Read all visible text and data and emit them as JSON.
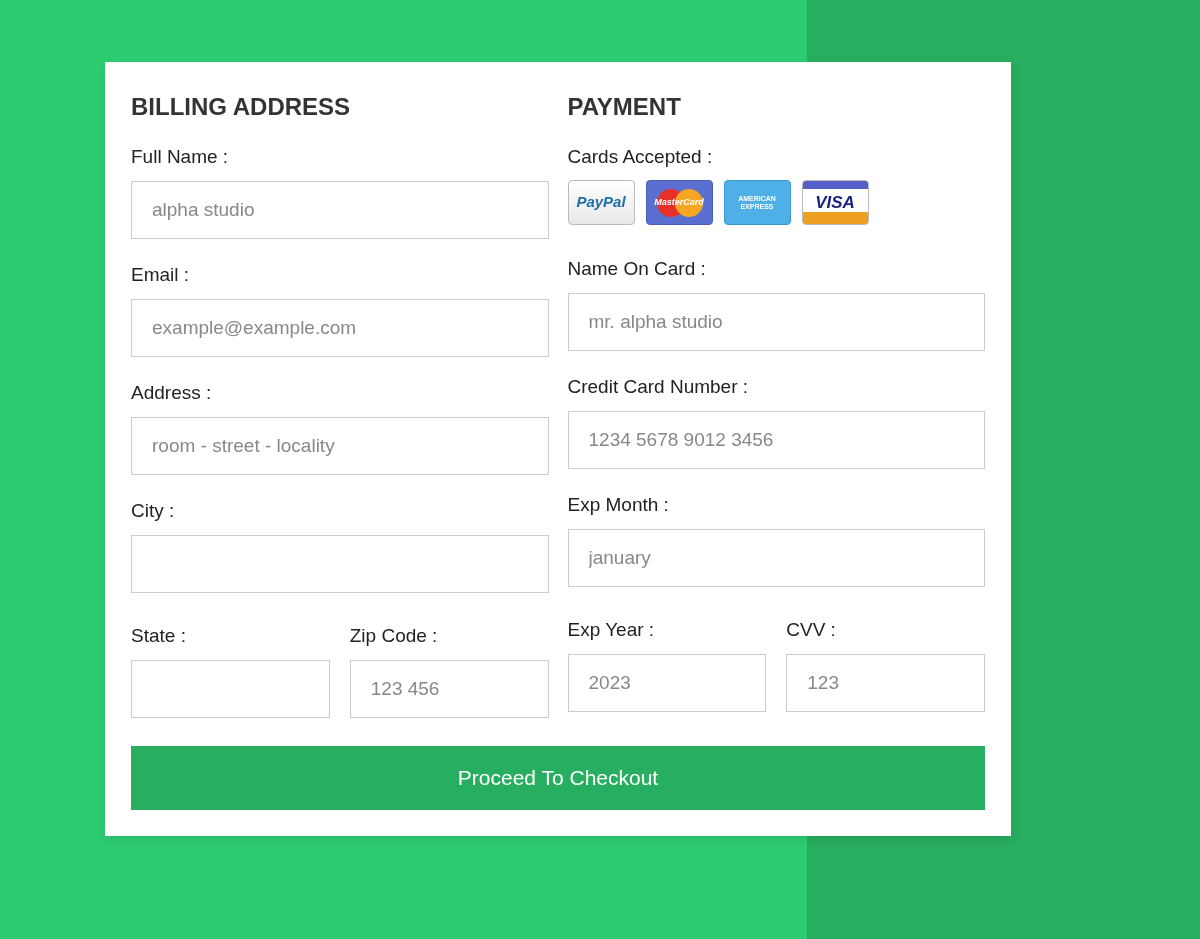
{
  "columns": [
    {
      "heading": "BILLING ADDRESS",
      "items": [
        {
          "kind": "field",
          "label": "Full Name :",
          "placeholder": "alpha studio"
        },
        {
          "kind": "field",
          "label": "Email :",
          "placeholder": "example@example.com"
        },
        {
          "kind": "field",
          "label": "Address :",
          "placeholder": "room - street - locality"
        },
        {
          "kind": "field",
          "label": "City :"
        },
        {
          "kind": "pair",
          "fields": [
            {
              "label": "State :"
            },
            {
              "label": "Zip Code :",
              "placeholder": "123 456"
            }
          ]
        }
      ]
    },
    {
      "heading": "PAYMENT",
      "items": [
        {
          "kind": "cards",
          "label": "Cards Accepted :",
          "cards": [
            {
              "kind": "paypal",
              "text": "PayPal"
            },
            {
              "kind": "mastercard",
              "text": "MasterCard"
            },
            {
              "kind": "amex",
              "text": "AMERICAN EXPRESS"
            },
            {
              "kind": "visa",
              "text": "VISA"
            }
          ]
        },
        {
          "kind": "field",
          "label": "Name On Card :",
          "placeholder": "mr. alpha studio"
        },
        {
          "kind": "field",
          "label": "Credit Card Number :",
          "placeholder": "1234 5678 9012 3456"
        },
        {
          "kind": "field",
          "label": "Exp Month :",
          "placeholder": "january"
        },
        {
          "kind": "pair",
          "fields": [
            {
              "label": "Exp Year :",
              "placeholder": "2023"
            },
            {
              "label": "CVV :",
              "placeholder": "123"
            }
          ]
        }
      ]
    }
  ],
  "submit": "Proceed To Checkout"
}
